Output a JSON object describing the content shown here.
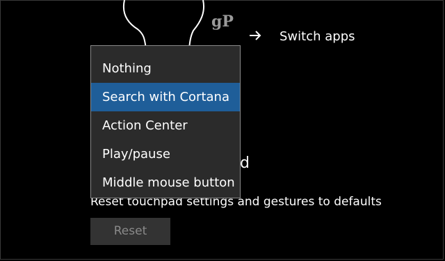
{
  "gesture": {
    "watermark": "gP",
    "action_label": "Switch apps",
    "icon": "arrow-right-icon"
  },
  "dropdown": {
    "selected_index": 1,
    "accent_color": "#1f5e99",
    "options": [
      {
        "label": "Nothing"
      },
      {
        "label": "Search with Cortana"
      },
      {
        "label": "Action Center"
      },
      {
        "label": "Play/pause"
      },
      {
        "label": "Middle mouse button"
      }
    ]
  },
  "reset_section": {
    "heading_visible": "d",
    "description": "Reset touchpad settings and gestures to defaults",
    "button_label": "Reset"
  }
}
